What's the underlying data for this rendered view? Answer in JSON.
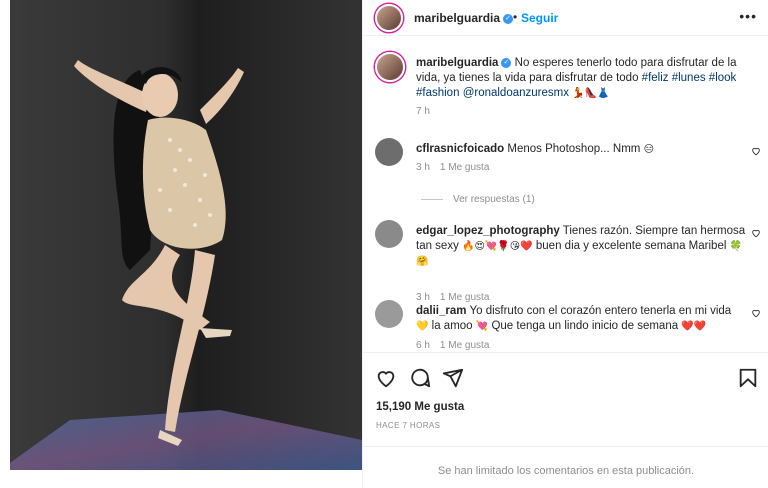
{
  "header": {
    "username": "maribelguardia",
    "dot": "•",
    "follow_label": "Seguir",
    "more_label": "•••"
  },
  "caption": {
    "username": "maribelguardia",
    "text_1": "No esperes tenerlo todo para disfrutar de la vida, ya tienes la vida para disfrutar de todo",
    "hashtags": "#feliz #lunes #look #fashion",
    "mention": "@ronaldoanzuresmx",
    "emoji": "💃👠👗",
    "time": "7 h"
  },
  "comments": [
    {
      "username": "cflrasnicfoicado",
      "text": "Menos Photoshop... Nmm",
      "emoji": "😑",
      "time": "3 h",
      "likes": "1 Me gusta",
      "replies": "Ver respuestas (1)"
    },
    {
      "username": "edgar_lopez_photography",
      "text_1": "Tienes razón. Siempre tan hermosa tan sexy",
      "emoji_1": "🔥😍💘🌹😘❤️",
      "text_2": "buen dia y excelente semana Maribel",
      "emoji_2": "🍀🤗",
      "time": "3 h",
      "likes": "1 Me gusta"
    },
    {
      "username": "dalii_ram",
      "text_1": "Yo disfruto con el corazón entero tenerla en mi vida",
      "emoji_1": "💛",
      "text_2": "la amoo",
      "emoji_2": "💘",
      "text_3": "Que tenga un lindo inicio de semana",
      "emoji_3": "❤️❤️",
      "time": "6 h",
      "likes": "1 Me gusta"
    }
  ],
  "likes_count": "15,190 Me gusta",
  "timestamp": "HACE 7 HORAS",
  "comments_limited": "Se han limitado los comentarios en esta publicación.",
  "colors": {
    "accent": "#0095f6",
    "link": "#00376b",
    "muted": "#8e8e8e",
    "verified": "#3897f0"
  },
  "icons": [
    "heart-icon",
    "comment-icon",
    "share-icon",
    "bookmark-icon",
    "verified-icon",
    "more-icon"
  ]
}
